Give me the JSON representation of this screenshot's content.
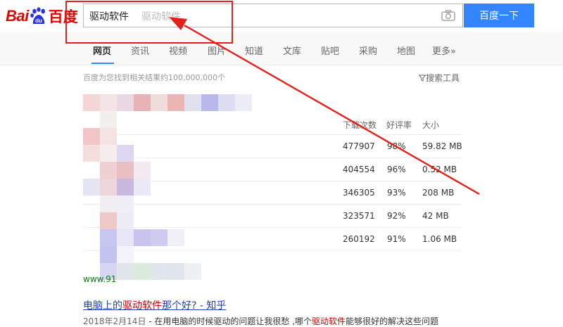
{
  "logo": {
    "latin": "Bai",
    "paw": "du",
    "chinese": "百度"
  },
  "search": {
    "query": "驱动软件",
    "suggestion": "驱动软件",
    "button": "百度一下"
  },
  "nav": {
    "tabs": [
      {
        "label": "网页",
        "active": true
      },
      {
        "label": "资讯"
      },
      {
        "label": "视频"
      },
      {
        "label": "图片"
      },
      {
        "label": "知道"
      },
      {
        "label": "文库"
      },
      {
        "label": "贴吧"
      },
      {
        "label": "采购"
      },
      {
        "label": "地图"
      },
      {
        "label": "更多»"
      }
    ]
  },
  "results_info": {
    "count_text": "百度为您找到相关结果约100,000,000个",
    "tools": "搜索工具"
  },
  "table": {
    "headers": [
      "下载次数",
      "好评率",
      "大小"
    ],
    "rows": [
      [
        "477907",
        "98%",
        "59.82 MB"
      ],
      [
        "404554",
        "96%",
        "0.52 MB"
      ],
      [
        "346305",
        "93%",
        "208 MB"
      ],
      [
        "323571",
        "92%",
        "42 MB"
      ],
      [
        "260192",
        "91%",
        "1.06 MB"
      ]
    ]
  },
  "partial_url": "www.91",
  "result2": {
    "title_pre": "电脑上的",
    "title_hl": "驱动软件",
    "title_post": "那个好? - 知乎",
    "date": "2018年2月14日",
    "snippet_pre": " - 在用电脑的时候驱动的问题让我很愁 ,哪个",
    "snippet_hl": "驱动软件",
    "snippet_post": "能够很好的解决这些问题"
  },
  "colors": {
    "brand_red": "#e10601",
    "button_blue": "#3385ff",
    "annotation_red": "#e3201c"
  }
}
